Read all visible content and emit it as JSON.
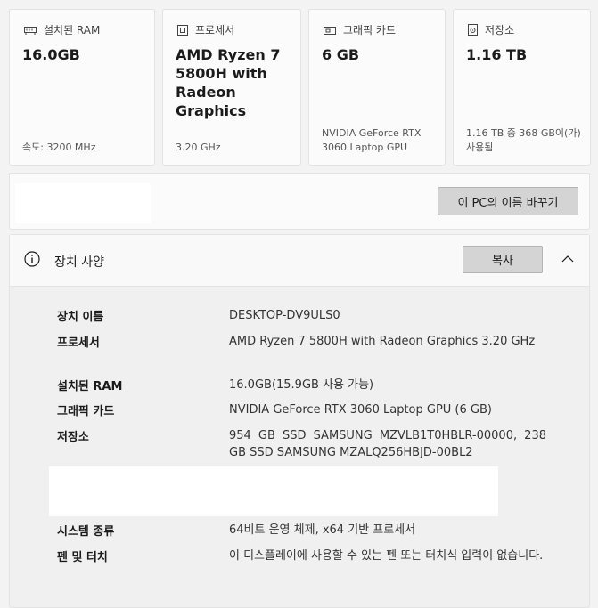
{
  "cards": [
    {
      "caption": "설치된 RAM",
      "value": "16.0GB",
      "sub": "속도: 3200 MHz",
      "icon": "ram-icon"
    },
    {
      "caption": "프로세서",
      "value": "AMD Ryzen 7 5800H with Radeon Graphics",
      "sub": "3.20 GHz",
      "icon": "processor-icon"
    },
    {
      "caption": "그래픽 카드",
      "value": "6 GB",
      "sub": "NVIDIA GeForce RTX 3060 Laptop GPU",
      "icon": "graphics-card-icon"
    },
    {
      "caption": "저장소",
      "value": "1.16 TB",
      "sub": "1.16 TB 중 368 GB이(가) 사용됨",
      "icon": "storage-icon"
    }
  ],
  "rename_button": "이 PC의 이름 바꾸기",
  "specs": {
    "title": "장치 사양",
    "copy_button": "복사",
    "rows": [
      {
        "label": "장치 이름",
        "value": "DESKTOP-DV9ULS0"
      },
      {
        "label": "프로세서",
        "value": "AMD Ryzen 7 5800H with Radeon Graphics 3.20 GHz"
      },
      {
        "label": "설치된 RAM",
        "value": "16.0GB(15.9GB 사용 가능)"
      },
      {
        "label": "그래픽 카드",
        "value": "NVIDIA GeForce RTX 3060 Laptop GPU (6 GB)"
      },
      {
        "label": "저장소",
        "value": "954 GB SSD SAMSUNG MZVLB1T0HBLR-00000, 238 GB SSD SAMSUNG MZALQ256HBJD-00BL2"
      },
      {
        "label": "시스템 종류",
        "value": "64비트 운영 체제, x64 기반 프로세서"
      },
      {
        "label": "펜 및 터치",
        "value": "이 디스플레이에 사용할 수 있는 펜 또는 터치식 입력이 없습니다."
      }
    ]
  }
}
